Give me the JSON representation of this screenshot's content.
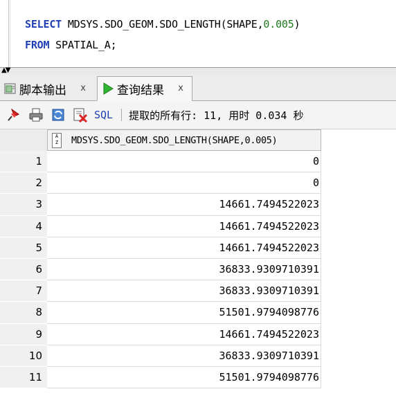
{
  "editor": {
    "line1": {
      "keyword": "SELECT",
      "expr": " MDSYS.SDO_GEOM.SDO_LENGTH(SHAPE,",
      "number": "0.005",
      "close": ")"
    },
    "line2": {
      "keyword": "FROM",
      "rest": " SPATIAL_A;"
    }
  },
  "tabs": [
    {
      "label": "脚本输出",
      "close": "x",
      "icon": "script-output-icon"
    },
    {
      "label": "查询结果",
      "close": "x",
      "icon": "run-triangle-icon"
    }
  ],
  "toolbar": {
    "sql_label": "SQL",
    "status": "提取的所有行: 11, 用时 0.034 秒"
  },
  "colors": {
    "keyword": "#1f3fb4",
    "number": "#1c7a1c",
    "run_icon": "#2fb52f"
  },
  "grid": {
    "column_header": "MDSYS.SDO_GEOM.SDO_LENGTH(SHAPE,0.005)",
    "rows": [
      {
        "n": "1",
        "v": "0"
      },
      {
        "n": "2",
        "v": "0"
      },
      {
        "n": "3",
        "v": "14661.7494522023"
      },
      {
        "n": "4",
        "v": "14661.7494522023"
      },
      {
        "n": "5",
        "v": "14661.7494522023"
      },
      {
        "n": "6",
        "v": "36833.9309710391"
      },
      {
        "n": "7",
        "v": "36833.9309710391"
      },
      {
        "n": "8",
        "v": "51501.9794098776"
      },
      {
        "n": "9",
        "v": "14661.7494522023"
      },
      {
        "n": "10",
        "v": "36833.9309710391"
      },
      {
        "n": "11",
        "v": "51501.9794098776"
      }
    ]
  }
}
